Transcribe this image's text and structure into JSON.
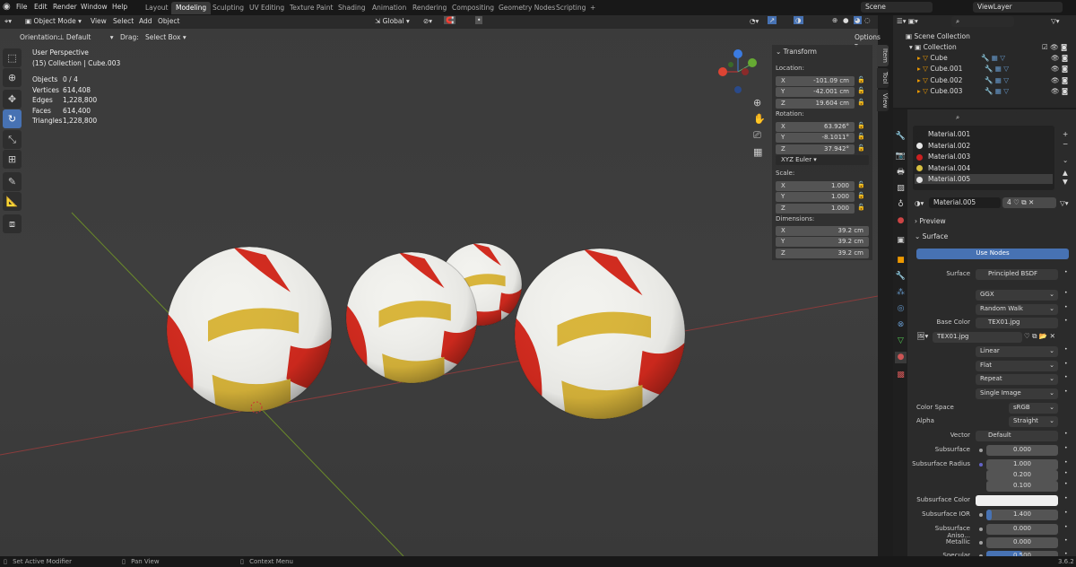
{
  "topbar": {
    "menus": [
      "File",
      "Edit",
      "Render",
      "Window",
      "Help"
    ],
    "workspaces": [
      "Layout",
      "Modeling",
      "Sculpting",
      "UV Editing",
      "Texture Paint",
      "Shading",
      "Animation",
      "Rendering",
      "Compositing",
      "Geometry Nodes",
      "Scripting"
    ],
    "active_workspace": "Modeling",
    "add_tab": "+",
    "scene": "Scene",
    "view_layer": "ViewLayer"
  },
  "viewport_header": {
    "mode": "Object Mode",
    "menus": [
      "View",
      "Select",
      "Add",
      "Object"
    ],
    "orientation_global": "Global",
    "options": "Options"
  },
  "tool_settings": {
    "orientation_label": "Orientation:",
    "orientation_value": "Default",
    "drag_label": "Drag:",
    "drag_value": "Select Box"
  },
  "overlay": {
    "view_name": "User Perspective",
    "collection": "(15) Collection | Cube.003",
    "stats": [
      {
        "label": "Objects",
        "value": "0 / 4"
      },
      {
        "label": "Vertices",
        "value": "614,408"
      },
      {
        "label": "Edges",
        "value": "1,228,800"
      },
      {
        "label": "Faces",
        "value": "614,400"
      },
      {
        "label": "Triangles",
        "value": "1,228,800"
      }
    ]
  },
  "toolbar": [
    {
      "icon": "select-box-icon",
      "active": false
    },
    {
      "icon": "cursor-icon",
      "active": false
    },
    {
      "icon": "move-icon",
      "active": false
    },
    {
      "icon": "rotate-icon",
      "active": true
    },
    {
      "icon": "scale-icon",
      "active": false
    },
    {
      "icon": "transform-icon",
      "active": false
    },
    {
      "icon": "annotate-icon",
      "active": false
    },
    {
      "icon": "measure-icon",
      "active": false
    },
    {
      "icon": "add-cube-icon",
      "active": false
    }
  ],
  "npanel": {
    "title": "Transform",
    "tabs": [
      "Item",
      "Tool",
      "View"
    ],
    "location_label": "Location:",
    "location": [
      {
        "axis": "X",
        "value": "-101.09 cm"
      },
      {
        "axis": "Y",
        "value": "-42.001 cm"
      },
      {
        "axis": "Z",
        "value": "19.604 cm"
      }
    ],
    "rotation_label": "Rotation:",
    "rotation": [
      {
        "axis": "X",
        "value": "63.926°"
      },
      {
        "axis": "Y",
        "value": "-8.1011°"
      },
      {
        "axis": "Z",
        "value": "37.942°"
      }
    ],
    "rotation_mode": "XYZ Euler",
    "scale_label": "Scale:",
    "scale": [
      {
        "axis": "X",
        "value": "1.000"
      },
      {
        "axis": "Y",
        "value": "1.000"
      },
      {
        "axis": "Z",
        "value": "1.000"
      }
    ],
    "dimensions_label": "Dimensions:",
    "dimensions": [
      {
        "axis": "X",
        "value": "39.2 cm"
      },
      {
        "axis": "Y",
        "value": "39.2 cm"
      },
      {
        "axis": "Z",
        "value": "39.2 cm"
      }
    ]
  },
  "outliner": {
    "root": "Scene Collection",
    "collection": "Collection",
    "objects": [
      "Cube",
      "Cube.001",
      "Cube.002",
      "Cube.003"
    ]
  },
  "materials": {
    "slots": [
      {
        "name": "Material.001",
        "color": "#222222"
      },
      {
        "name": "Material.002",
        "color": "#e8e8e8"
      },
      {
        "name": "Material.003",
        "color": "#cc2020"
      },
      {
        "name": "Material.004",
        "color": "#d8c040"
      },
      {
        "name": "Material.005",
        "color": "#e0e0e0"
      }
    ],
    "active": "Material.005",
    "users": "4",
    "preview": "Preview",
    "surface_panel": "Surface",
    "use_nodes": "Use Nodes"
  },
  "surface": {
    "rows": [
      {
        "label": "Surface",
        "value": "Principled BSDF",
        "socket": "#63c763"
      },
      {
        "label": "",
        "value": "GGX",
        "dropdown": true
      },
      {
        "label": "",
        "value": "Random Walk",
        "dropdown": true
      },
      {
        "label": "Base Color",
        "value": "TEX01.jpg",
        "socket": "#c7c729"
      },
      {
        "label": "",
        "value": "TEX01.jpg",
        "image": true
      },
      {
        "label": "",
        "value": "Linear",
        "dropdown": true
      },
      {
        "label": "",
        "value": "Flat",
        "dropdown": true
      },
      {
        "label": "",
        "value": "Repeat",
        "dropdown": true
      },
      {
        "label": "",
        "value": "Single Image",
        "dropdown": true
      },
      {
        "label": "Color Space",
        "value": "sRGB",
        "dropdown": true,
        "left": true
      },
      {
        "label": "Alpha",
        "value": "Straight",
        "dropdown": true,
        "left": true
      },
      {
        "label": "Vector",
        "value": "Default",
        "socket": "#6363c7"
      },
      {
        "label": "Subsurface",
        "value": "0.000",
        "socket": "#a1a1a1",
        "num": true
      },
      {
        "label": "Subsurface Radius",
        "value": "1.000",
        "socket": "#6363c7",
        "num": true
      },
      {
        "label": "",
        "value": "0.200",
        "num": true
      },
      {
        "label": "",
        "value": "0.100",
        "num": true
      },
      {
        "label": "Subsurface Color",
        "value": "",
        "socket": "#c7c729",
        "color": "#f0f0f0"
      },
      {
        "label": "Subsurface IOR",
        "value": "1.400",
        "socket": "#a1a1a1",
        "num": true,
        "fill": 0.07
      },
      {
        "label": "Subsurface Aniso...",
        "value": "0.000",
        "socket": "#a1a1a1",
        "num": true
      },
      {
        "label": "Metallic",
        "value": "0.000",
        "socket": "#a1a1a1",
        "num": true
      },
      {
        "label": "Specular",
        "value": "0.500",
        "socket": "#a1a1a1",
        "num": true,
        "fill": 0.5
      }
    ]
  },
  "statusbar": {
    "items": [
      "Set Active Modifier",
      "Pan View",
      "Context Menu"
    ],
    "version": "3.6.2"
  },
  "colors": {
    "accent": "#4772b3",
    "ball_red": "#d42a1e",
    "ball_yellow": "#d9b53a",
    "ball_white": "#f2f2ee"
  }
}
